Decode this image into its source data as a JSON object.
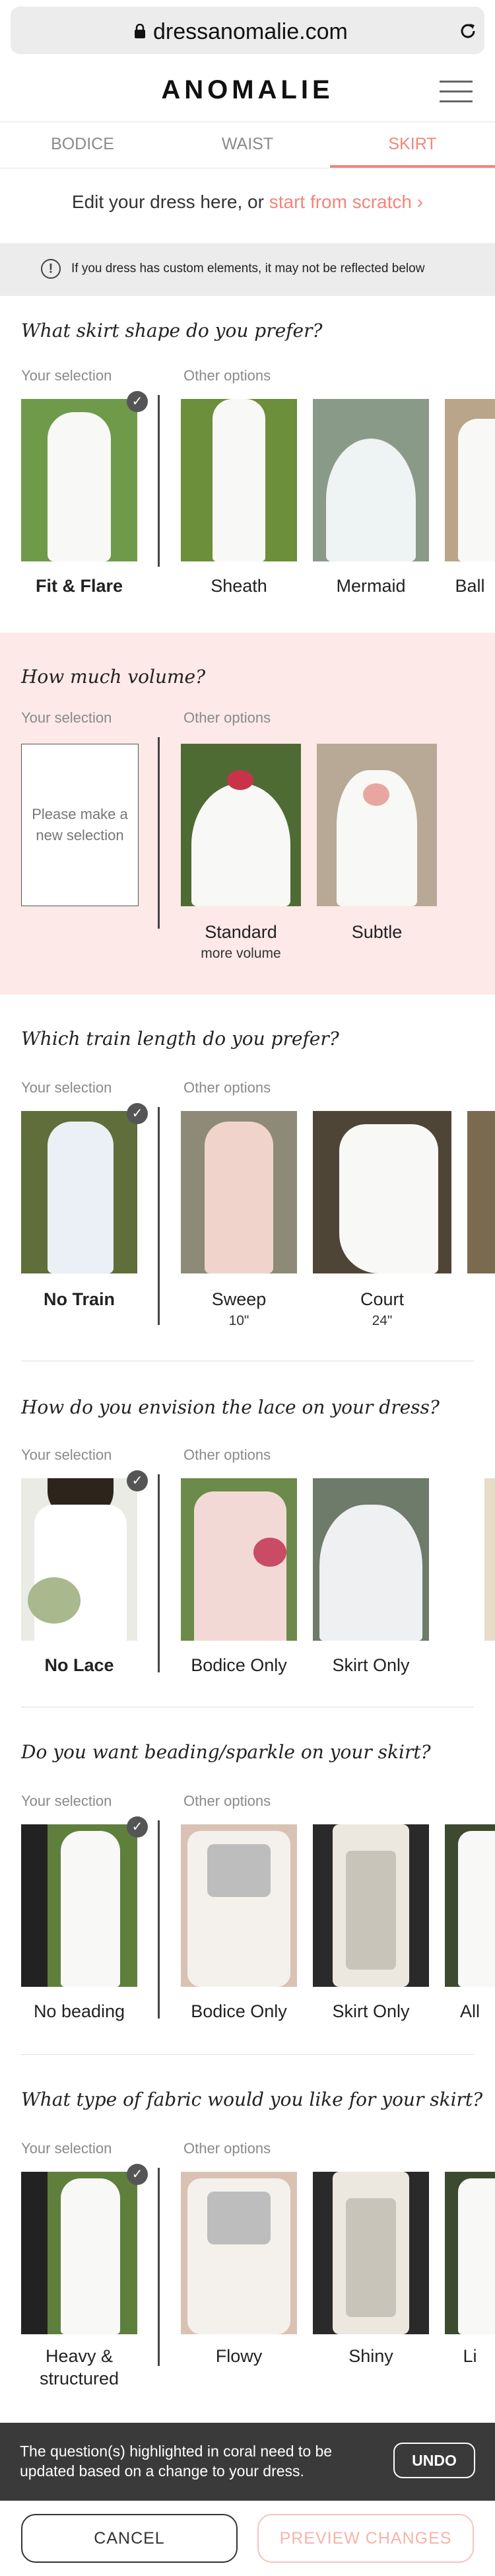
{
  "browser": {
    "url": "dressanomalie.com"
  },
  "header": {
    "logo": "ANOMALIE"
  },
  "tabs": [
    {
      "label": "BODICE"
    },
    {
      "label": "WAIST"
    },
    {
      "label": "SKIRT"
    }
  ],
  "edit": {
    "text": "Edit your dress here, or ",
    "link": "start from scratch"
  },
  "notice": {
    "text": "If you dress has custom elements, it may not be reflected below"
  },
  "labels": {
    "your_selection": "Your selection",
    "other_options": "Other options"
  },
  "sections": [
    {
      "question": "What skirt shape do you prefer?",
      "selected": {
        "label": "Fit & Flare"
      },
      "options": [
        {
          "label": "Sheath"
        },
        {
          "label": "Mermaid"
        },
        {
          "label": "Ball"
        }
      ]
    },
    {
      "question": "How much volume?",
      "selected": {
        "placeholder": "Please make a new selection"
      },
      "options": [
        {
          "label": "Standard",
          "sub": "more volume"
        },
        {
          "label": "Subtle"
        }
      ]
    },
    {
      "question": "Which train length do you prefer?",
      "selected": {
        "label": "No Train"
      },
      "options": [
        {
          "label": "Sweep",
          "sub": "10\""
        },
        {
          "label": "Court",
          "sub": "24\""
        }
      ]
    },
    {
      "question": "How do you envision the lace on your dress?",
      "selected": {
        "label": "No Lace"
      },
      "options": [
        {
          "label": "Bodice Only"
        },
        {
          "label": "Skirt Only"
        }
      ]
    },
    {
      "question": "Do you want beading/sparkle on your skirt?",
      "selected": {
        "label": "No beading"
      },
      "options": [
        {
          "label": "Bodice Only"
        },
        {
          "label": "Skirt Only"
        },
        {
          "label": "All"
        }
      ]
    },
    {
      "question": "What type of fabric would you like for your skirt?",
      "selected": {
        "label": "Heavy & structured"
      },
      "options": [
        {
          "label": "Flowy"
        },
        {
          "label": "Shiny"
        },
        {
          "label": "Li"
        }
      ]
    }
  ],
  "toast": {
    "text": "The question(s) highlighted in coral need to be updated based on a change to your dress.",
    "undo": "UNDO"
  },
  "buttons": {
    "cancel": "CANCEL",
    "preview": "PREVIEW CHANGES"
  },
  "colors": {
    "accent": "#f3857b",
    "highlight": "#fde9e7",
    "toast": "#3a3a3a"
  }
}
